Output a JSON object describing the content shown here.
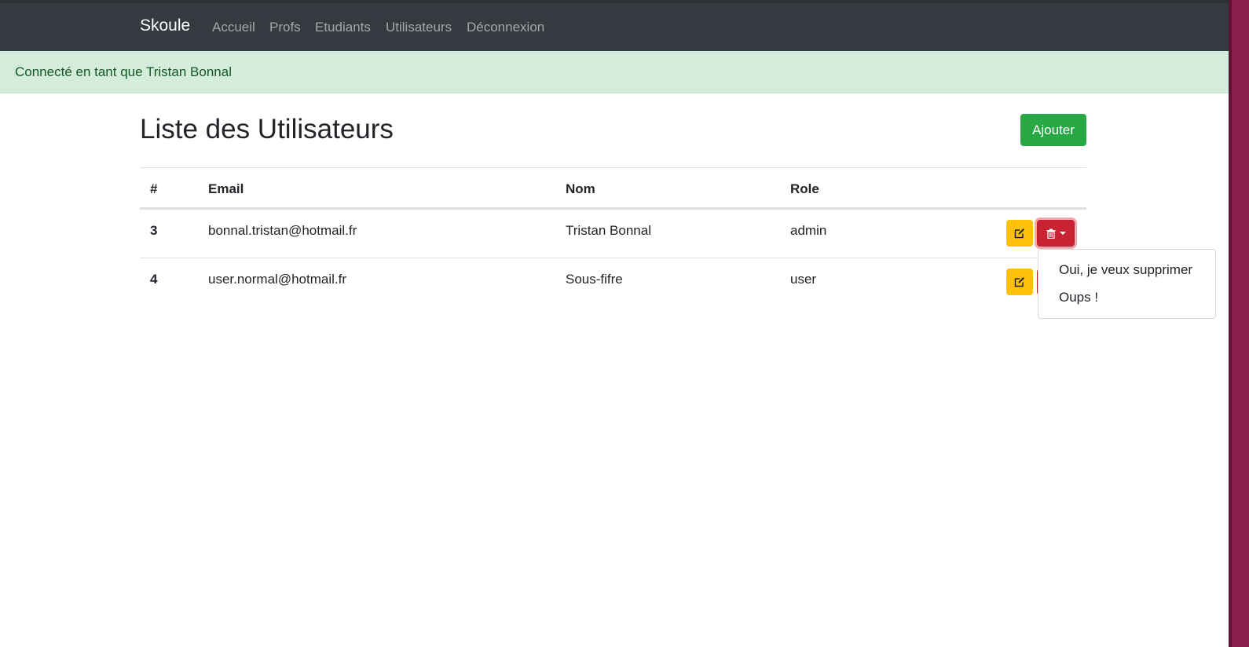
{
  "navbar": {
    "brand": "Skoule",
    "links": [
      "Accueil",
      "Profs",
      "Etudiants",
      "Utilisateurs",
      "Déconnexion"
    ]
  },
  "alert": {
    "text": "Connecté en tant que Tristan Bonnal"
  },
  "page": {
    "title": "Liste des Utilisateurs",
    "add_button": "Ajouter"
  },
  "table": {
    "headers": [
      "#",
      "Email",
      "Nom",
      "Role"
    ],
    "rows": [
      {
        "id": "3",
        "email": "bonnal.tristan@hotmail.fr",
        "nom": "Tristan Bonnal",
        "role": "admin"
      },
      {
        "id": "4",
        "email": "user.normal@hotmail.fr",
        "nom": "Sous-fifre",
        "role": "user"
      }
    ]
  },
  "delete_dropdown": {
    "items": [
      "Oui, je veux supprimer",
      "Oups !"
    ]
  },
  "colors": {
    "navbar": "#343a40",
    "alert_bg": "#d4edda",
    "alert_text": "#155724",
    "add_button": "#28a745",
    "edit_button": "#ffc107",
    "delete_button": "#c82333"
  }
}
